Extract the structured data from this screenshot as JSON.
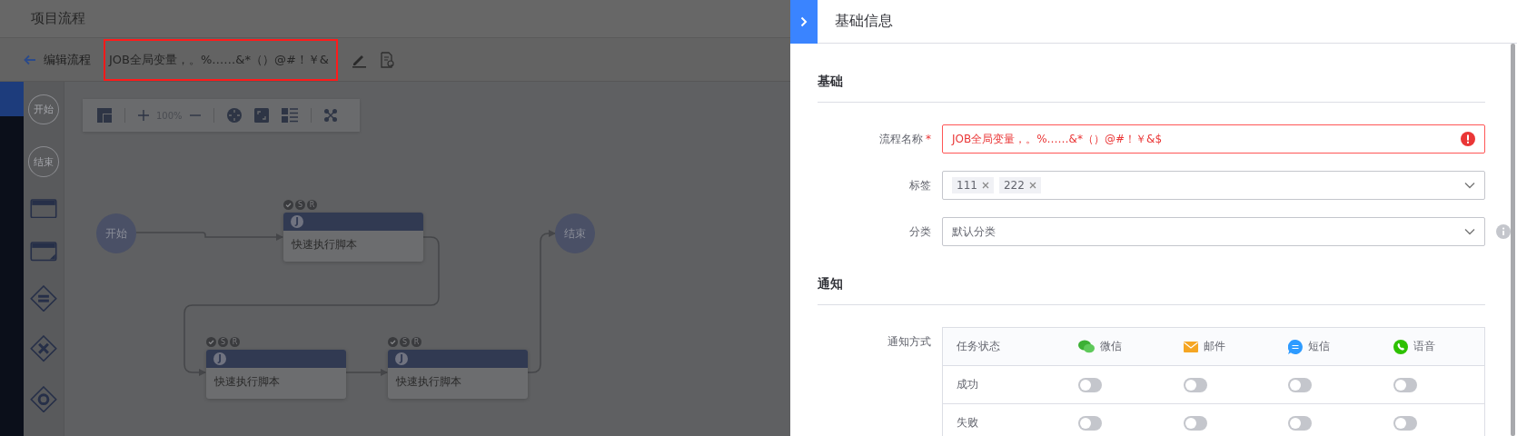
{
  "page_title": "项目流程",
  "toolbar": {
    "back_label": "编辑流程",
    "flow_name": "JOB全局变量，。%……&*（）@#！￥&",
    "flow_name_highlighted": true
  },
  "palette": [
    {
      "kind": "start",
      "label": "开始"
    },
    {
      "kind": "end",
      "label": "结束"
    },
    {
      "kind": "task"
    },
    {
      "kind": "subflow"
    },
    {
      "kind": "parallel"
    },
    {
      "kind": "exclusive"
    },
    {
      "kind": "inclusive"
    }
  ],
  "canvas_toolbar": {
    "zoom": "100%"
  },
  "canvas": {
    "start": {
      "label": "开始"
    },
    "end": {
      "label": "结束"
    },
    "nodes": [
      {
        "type_mark": "J",
        "status_marks": [
          "S",
          "R"
        ],
        "label": "快速执行脚本"
      },
      {
        "type_mark": "J",
        "status_marks": [
          "S",
          "R"
        ],
        "label": "快速执行脚本"
      },
      {
        "type_mark": "J",
        "status_marks": [
          "S",
          "R"
        ],
        "label": "快速执行脚本"
      }
    ]
  },
  "panel": {
    "title": "基础信息",
    "sections": [
      {
        "title": "基础",
        "fields": [
          {
            "kind": "text",
            "label": "流程名称",
            "required_mark": "*",
            "error": true,
            "value": "JOB全局变量，。%……&*（）@#！￥&$"
          },
          {
            "kind": "tags",
            "label": "标签",
            "tags": [
              "111",
              "222"
            ]
          },
          {
            "kind": "select",
            "label": "分类",
            "value": "默认分类",
            "info": true
          }
        ]
      },
      {
        "title": "通知",
        "fields": [
          {
            "kind": "notify",
            "label": "通知方式"
          }
        ]
      }
    ],
    "notify": {
      "columns": [
        {
          "kind": "status",
          "label": "任务状态"
        },
        {
          "kind": "wechat",
          "label": "微信"
        },
        {
          "kind": "mail",
          "label": "邮件"
        },
        {
          "kind": "sms",
          "label": "短信"
        },
        {
          "kind": "voice",
          "label": "语音"
        }
      ],
      "rows": [
        {
          "status": "成功",
          "toggles": [
            false,
            false,
            false,
            false
          ]
        },
        {
          "status": "失败",
          "toggles": [
            false,
            false,
            false,
            false
          ]
        }
      ]
    }
  }
}
